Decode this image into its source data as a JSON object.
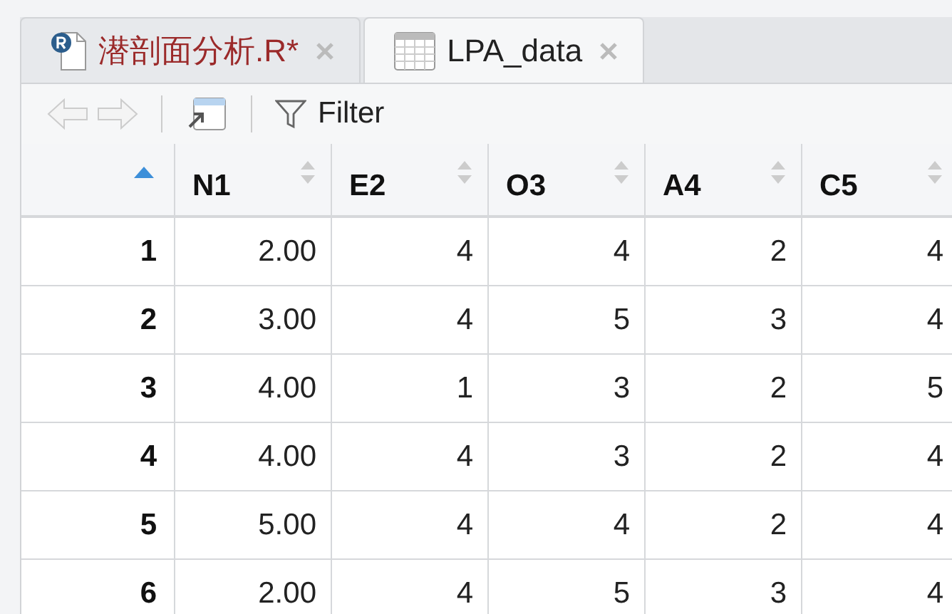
{
  "tabs": [
    {
      "label": "潜剖面分析.R*",
      "kind": "r-script",
      "modified": true,
      "selected": false
    },
    {
      "label": "LPA_data",
      "kind": "data",
      "modified": false,
      "selected": true
    }
  ],
  "toolbar": {
    "filter_label": "Filter"
  },
  "table": {
    "row_sort": {
      "sorted": true
    },
    "columns": [
      "N1",
      "E2",
      "O3",
      "A4",
      "C5"
    ],
    "rows": [
      {
        "index": "1",
        "cells": [
          "2.00",
          "4",
          "4",
          "2",
          "4"
        ]
      },
      {
        "index": "2",
        "cells": [
          "3.00",
          "4",
          "5",
          "3",
          "4"
        ]
      },
      {
        "index": "3",
        "cells": [
          "4.00",
          "1",
          "3",
          "2",
          "5"
        ]
      },
      {
        "index": "4",
        "cells": [
          "4.00",
          "4",
          "3",
          "2",
          "4"
        ]
      },
      {
        "index": "5",
        "cells": [
          "5.00",
          "4",
          "4",
          "2",
          "4"
        ]
      },
      {
        "index": "6",
        "cells": [
          "2.00",
          "4",
          "5",
          "3",
          "4"
        ]
      }
    ]
  }
}
